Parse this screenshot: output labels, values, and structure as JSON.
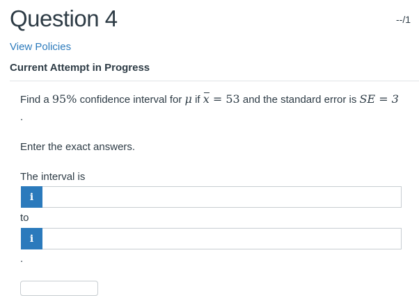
{
  "header": {
    "title": "Question 4",
    "score": "--/1"
  },
  "links": {
    "view_policies": "View Policies"
  },
  "status": {
    "attempt": "Current Attempt in Progress"
  },
  "question": {
    "part_find_a": "Find a ",
    "confidence": "95%",
    "part_interval_for": " confidence interval for ",
    "mu": "μ",
    "part_if": "  if ",
    "xbar": "x",
    "equals_53": " = 53",
    "part_standard_error": "  and the standard error is ",
    "se_expr": "SE = 3",
    "trailing_period": "."
  },
  "instructions": "Enter the exact answers.",
  "answers": {
    "interval_label": "The interval is",
    "info_glyph": "i",
    "lower_value": "",
    "to_label": "to",
    "upper_value": "",
    "trailing_period": "."
  },
  "colors": {
    "link": "#2b7abc",
    "info_button": "#2b7abc",
    "text": "#2d3b45"
  },
  "icons": {
    "info": "info-icon"
  }
}
